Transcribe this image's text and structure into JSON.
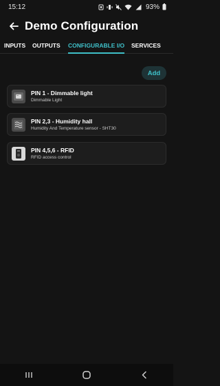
{
  "status_bar": {
    "time": "15:12",
    "battery_percent": "93%",
    "icons": [
      "notification-icon",
      "vibrate-icon",
      "mute-icon",
      "wifi-icon",
      "signal-icon",
      "battery-icon"
    ]
  },
  "app_bar": {
    "title": "Demo Configuration",
    "back_icon": "arrow-left-icon"
  },
  "tabs": [
    {
      "label": "INPUTS"
    },
    {
      "label": "OUTPUTS"
    },
    {
      "label": "CONFIGURABLE I/O",
      "active": true
    },
    {
      "label": "SERVICES"
    }
  ],
  "add_button": {
    "label": "Add"
  },
  "pins": [
    {
      "title": "PIN 1 - Dimmable light",
      "subtitle": "Dimmable Light",
      "icon": "dimmer-icon"
    },
    {
      "title": "PIN 2,3 - Humidity hall",
      "subtitle": "Humidity And Temperature sensor - SHT30",
      "icon": "humidity-icon"
    },
    {
      "title": "PIN 4,5,6 - RFID",
      "subtitle": "RFID access control",
      "icon": "rfid-reader-icon"
    }
  ],
  "colors": {
    "background": "#141414",
    "accent": "#3fc0c9",
    "card": "#1d1d1d"
  }
}
